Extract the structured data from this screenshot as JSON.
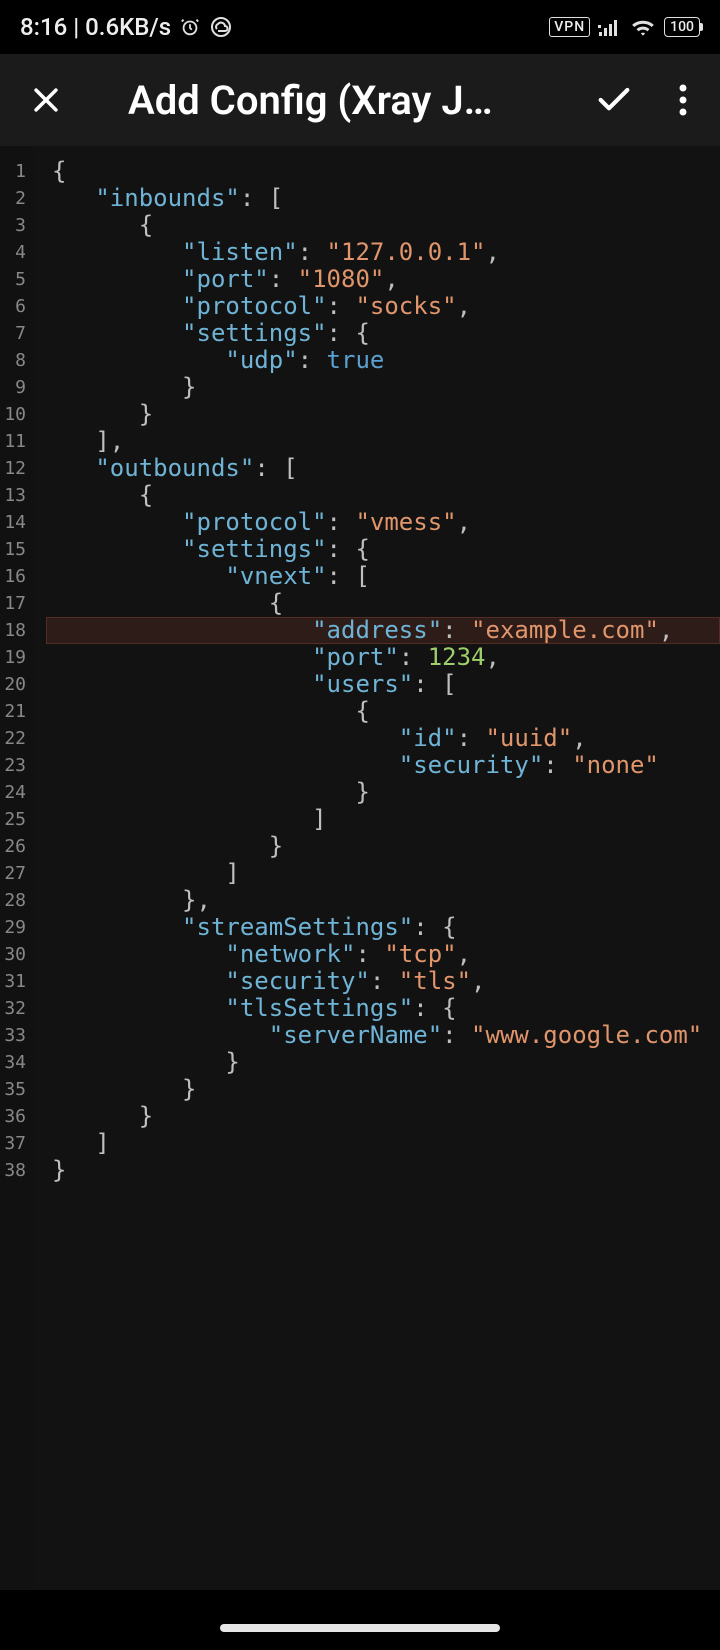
{
  "statusbar": {
    "time_rate": "8:16 | 0.6KB/s",
    "vpn": "VPN",
    "battery": "100"
  },
  "appbar": {
    "title": "Add Config (Xray J…"
  },
  "code": {
    "highlighted_line": 18,
    "lines": [
      [
        [
          "punc",
          "{"
        ]
      ],
      [
        [
          "indent",
          1
        ],
        [
          "key",
          "\"inbounds\""
        ],
        [
          "punc",
          ": ["
        ]
      ],
      [
        [
          "indent",
          2
        ],
        [
          "punc",
          "{"
        ]
      ],
      [
        [
          "indent",
          3
        ],
        [
          "key",
          "\"listen\""
        ],
        [
          "punc",
          ": "
        ],
        [
          "str",
          "\"127.0.0.1\""
        ],
        [
          "punc",
          ","
        ]
      ],
      [
        [
          "indent",
          3
        ],
        [
          "key",
          "\"port\""
        ],
        [
          "punc",
          ": "
        ],
        [
          "str",
          "\"1080\""
        ],
        [
          "punc",
          ","
        ]
      ],
      [
        [
          "indent",
          3
        ],
        [
          "key",
          "\"protocol\""
        ],
        [
          "punc",
          ": "
        ],
        [
          "str",
          "\"socks\""
        ],
        [
          "punc",
          ","
        ]
      ],
      [
        [
          "indent",
          3
        ],
        [
          "key",
          "\"settings\""
        ],
        [
          "punc",
          ": {"
        ]
      ],
      [
        [
          "indent",
          4
        ],
        [
          "key",
          "\"udp\""
        ],
        [
          "punc",
          ": "
        ],
        [
          "bool",
          "true"
        ]
      ],
      [
        [
          "indent",
          3
        ],
        [
          "punc",
          "}"
        ]
      ],
      [
        [
          "indent",
          2
        ],
        [
          "punc",
          "}"
        ]
      ],
      [
        [
          "indent",
          1
        ],
        [
          "punc",
          "],"
        ]
      ],
      [
        [
          "indent",
          1
        ],
        [
          "key",
          "\"outbounds\""
        ],
        [
          "punc",
          ": ["
        ]
      ],
      [
        [
          "indent",
          2
        ],
        [
          "punc",
          "{"
        ]
      ],
      [
        [
          "indent",
          3
        ],
        [
          "key",
          "\"protocol\""
        ],
        [
          "punc",
          ": "
        ],
        [
          "str",
          "\"vmess\""
        ],
        [
          "punc",
          ","
        ]
      ],
      [
        [
          "indent",
          3
        ],
        [
          "key",
          "\"settings\""
        ],
        [
          "punc",
          ": {"
        ]
      ],
      [
        [
          "indent",
          4
        ],
        [
          "key",
          "\"vnext\""
        ],
        [
          "punc",
          ": ["
        ]
      ],
      [
        [
          "indent",
          5
        ],
        [
          "punc",
          "{"
        ]
      ],
      [
        [
          "indent",
          6
        ],
        [
          "key",
          "\"address\""
        ],
        [
          "punc",
          ": "
        ],
        [
          "str",
          "\"example.com\""
        ],
        [
          "punc",
          ","
        ]
      ],
      [
        [
          "indent",
          6
        ],
        [
          "key",
          "\"port\""
        ],
        [
          "punc",
          ": "
        ],
        [
          "num",
          "1234"
        ],
        [
          "punc",
          ","
        ]
      ],
      [
        [
          "indent",
          6
        ],
        [
          "key",
          "\"users\""
        ],
        [
          "punc",
          ": ["
        ]
      ],
      [
        [
          "indent",
          7
        ],
        [
          "punc",
          "{"
        ]
      ],
      [
        [
          "indent",
          8
        ],
        [
          "key",
          "\"id\""
        ],
        [
          "punc",
          ": "
        ],
        [
          "str",
          "\"uuid\""
        ],
        [
          "punc",
          ","
        ]
      ],
      [
        [
          "indent",
          8
        ],
        [
          "key",
          "\"security\""
        ],
        [
          "punc",
          ": "
        ],
        [
          "str",
          "\"none\""
        ]
      ],
      [
        [
          "indent",
          7
        ],
        [
          "punc",
          "}"
        ]
      ],
      [
        [
          "indent",
          6
        ],
        [
          "punc",
          "]"
        ]
      ],
      [
        [
          "indent",
          5
        ],
        [
          "punc",
          "}"
        ]
      ],
      [
        [
          "indent",
          4
        ],
        [
          "punc",
          "]"
        ]
      ],
      [
        [
          "indent",
          3
        ],
        [
          "punc",
          "},"
        ]
      ],
      [
        [
          "indent",
          3
        ],
        [
          "key",
          "\"streamSettings\""
        ],
        [
          "punc",
          ": {"
        ]
      ],
      [
        [
          "indent",
          4
        ],
        [
          "key",
          "\"network\""
        ],
        [
          "punc",
          ": "
        ],
        [
          "str",
          "\"tcp\""
        ],
        [
          "punc",
          ","
        ]
      ],
      [
        [
          "indent",
          4
        ],
        [
          "key",
          "\"security\""
        ],
        [
          "punc",
          ": "
        ],
        [
          "str",
          "\"tls\""
        ],
        [
          "punc",
          ","
        ]
      ],
      [
        [
          "indent",
          4
        ],
        [
          "key",
          "\"tlsSettings\""
        ],
        [
          "punc",
          ": {"
        ]
      ],
      [
        [
          "indent",
          5
        ],
        [
          "key",
          "\"serverName\""
        ],
        [
          "punc",
          ": "
        ],
        [
          "str",
          "\"www.google.com\""
        ]
      ],
      [
        [
          "indent",
          4
        ],
        [
          "punc",
          "}"
        ]
      ],
      [
        [
          "indent",
          3
        ],
        [
          "punc",
          "}"
        ]
      ],
      [
        [
          "indent",
          2
        ],
        [
          "punc",
          "}"
        ]
      ],
      [
        [
          "indent",
          1
        ],
        [
          "punc",
          "]"
        ]
      ],
      [
        [
          "punc",
          "}"
        ]
      ]
    ]
  }
}
